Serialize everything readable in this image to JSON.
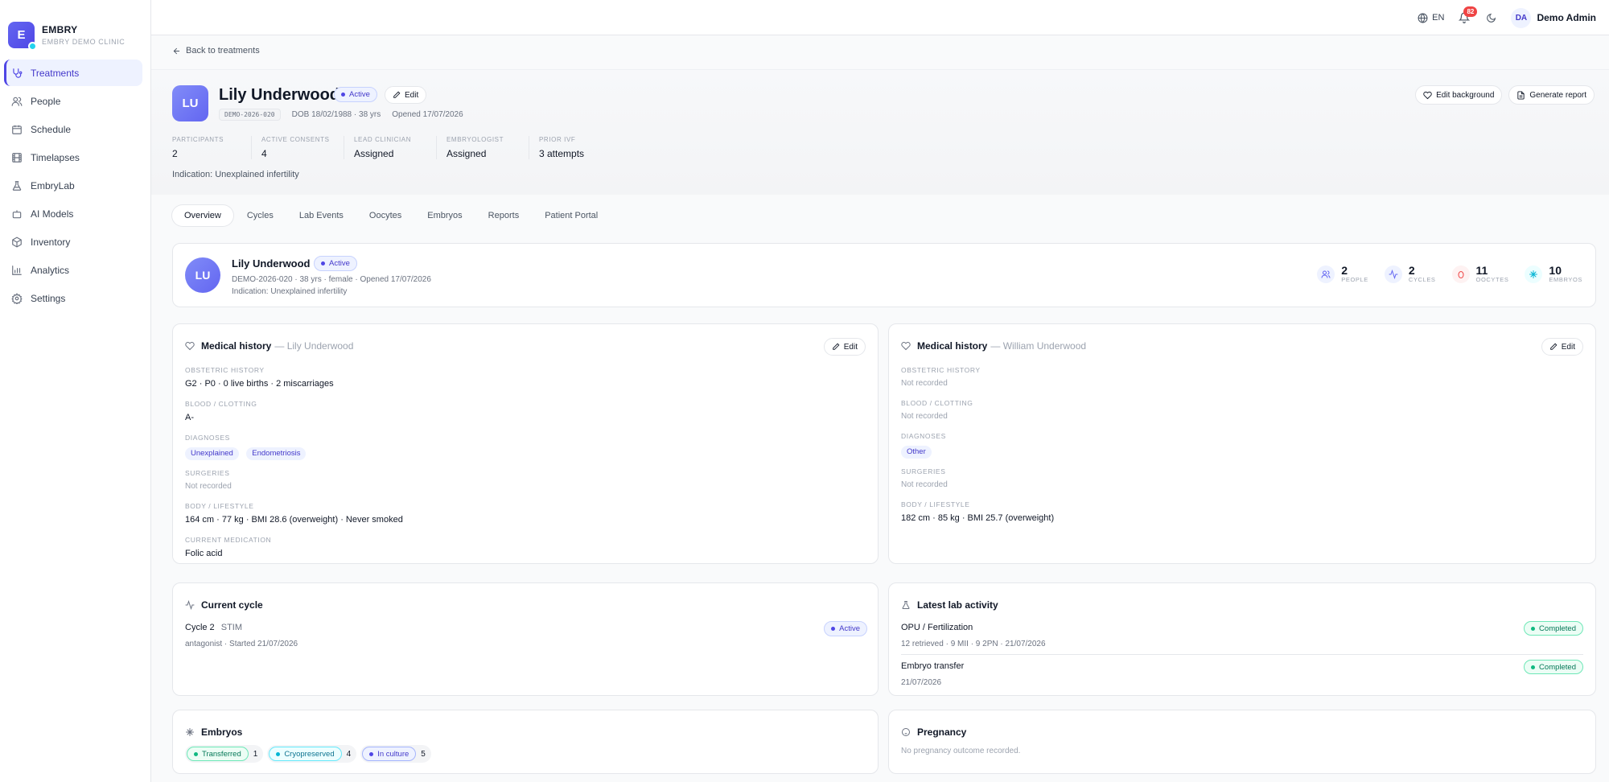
{
  "brand": {
    "logo_letter": "E",
    "name": "EMBRY",
    "clinic": "EMBRY DEMO CLINIC"
  },
  "nav": [
    {
      "label": "Treatments",
      "icon": "stethoscope-icon",
      "active": true
    },
    {
      "label": "People",
      "icon": "users-icon"
    },
    {
      "label": "Schedule",
      "icon": "calendar-icon"
    },
    {
      "label": "Timelapses",
      "icon": "film-icon"
    },
    {
      "label": "EmbryLab",
      "icon": "flask-icon"
    },
    {
      "label": "AI Models",
      "icon": "bot-icon"
    },
    {
      "label": "Inventory",
      "icon": "box-icon"
    },
    {
      "label": "Analytics",
      "icon": "bar-chart-icon"
    },
    {
      "label": "Settings",
      "icon": "gear-icon"
    }
  ],
  "topbar": {
    "language": "EN",
    "notifications": "82",
    "user_initials": "DA",
    "user_name": "Demo Admin"
  },
  "back_link": "Back to treatments",
  "patient": {
    "initials": "LU",
    "name": "Lily Underwood",
    "status": "Active",
    "edit_label": "Edit",
    "code": "DEMO-2026-020",
    "dob": "DOB 18/02/1988 · 38 yrs",
    "opened": "Opened 17/07/2026",
    "indication": "Indication: Unexplained infertility"
  },
  "header_actions": {
    "edit_background": "Edit background",
    "generate_report": "Generate report"
  },
  "stats": [
    {
      "label": "PARTICIPANTS",
      "value": "2"
    },
    {
      "label": "ACTIVE CONSENTS",
      "value": "4"
    },
    {
      "label": "LEAD CLINICIAN",
      "value": "Assigned"
    },
    {
      "label": "EMBRYOLOGIST",
      "value": "Assigned"
    },
    {
      "label": "PRIOR IVF",
      "value": "3 attempts"
    }
  ],
  "tabs": [
    "Overview",
    "Cycles",
    "Lab Events",
    "Oocytes",
    "Embryos",
    "Reports",
    "Patient Portal"
  ],
  "summary": {
    "initials": "LU",
    "name": "Lily Underwood",
    "status": "Active",
    "line": "DEMO-2026-020 · 38 yrs · female · Opened 17/07/2026",
    "indication": "Indication: Unexplained infertility",
    "counters": [
      {
        "value": "2",
        "label": "PEOPLE",
        "icon": "users-icon",
        "color": "#6366f1",
        "bg": "#eef2ff"
      },
      {
        "value": "2",
        "label": "CYCLES",
        "icon": "activity-icon",
        "color": "#6366f1",
        "bg": "#eef2ff"
      },
      {
        "value": "11",
        "label": "OOCYTES",
        "icon": "egg-icon",
        "color": "#ef4444",
        "bg": "#fef2f2"
      },
      {
        "value": "10",
        "label": "EMBRYOS",
        "icon": "sparkle-icon",
        "color": "#06b6d4",
        "bg": "#ecfeff"
      }
    ]
  },
  "medical_left": {
    "title": "Medical history",
    "person": "— Lily Underwood",
    "edit_label": "Edit",
    "obstetric_label": "OBSTETRIC HISTORY",
    "obstetric": "G2 · P0 · 0 live births · 2 miscarriages",
    "blood_label": "BLOOD / CLOTTING",
    "blood": "A-",
    "diagnoses_label": "DIAGNOSES",
    "diagnoses": [
      "Unexplained",
      "Endometriosis"
    ],
    "surgeries_label": "SURGERIES",
    "surgeries": "Not recorded",
    "body_label": "BODY / LIFESTYLE",
    "body": "164 cm · 77 kg · BMI 28.6 (overweight) · Never smoked",
    "medication_label": "CURRENT MEDICATION",
    "medication": "Folic acid"
  },
  "medical_right": {
    "title": "Medical history",
    "person": "— William Underwood",
    "edit_label": "Edit",
    "obstetric_label": "OBSTETRIC HISTORY",
    "obstetric": "Not recorded",
    "blood_label": "BLOOD / CLOTTING",
    "blood": "Not recorded",
    "diagnoses_label": "DIAGNOSES",
    "diagnoses": [
      "Other"
    ],
    "surgeries_label": "SURGERIES",
    "surgeries": "Not recorded",
    "body_label": "BODY / LIFESTYLE",
    "body": "182 cm · 85 kg · BMI 25.7 (overweight)"
  },
  "current_cycle": {
    "title": "Current cycle",
    "cycle": "Cycle 2",
    "phase": "STIM",
    "status": "Active",
    "details": "antagonist · Started 21/07/2026"
  },
  "lab_activity": {
    "title": "Latest lab activity",
    "items": [
      {
        "name": "OPU / Fertilization",
        "details": "12 retrieved · 9 MII · 9 2PN · 21/07/2026",
        "status": "Completed"
      },
      {
        "name": "Embryo transfer",
        "details": "21/07/2026",
        "status": "Completed"
      }
    ]
  },
  "embryos": {
    "title": "Embryos",
    "groups": [
      {
        "label": "Transferred",
        "count": "1",
        "style": "green"
      },
      {
        "label": "Cryopreserved",
        "count": "4",
        "style": "cyan"
      },
      {
        "label": "In culture",
        "count": "5",
        "style": "indigo"
      }
    ]
  },
  "pregnancy": {
    "title": "Pregnancy",
    "text": "No pregnancy outcome recorded."
  }
}
